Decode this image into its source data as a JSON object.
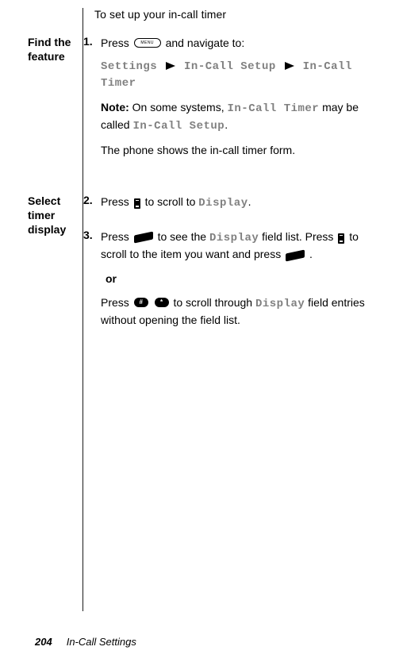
{
  "intro": "To set up your in-call timer",
  "sections": {
    "find": {
      "label": "Find the feature",
      "step1": {
        "num": "1.",
        "press_pre": "Press ",
        "press_post": " and navigate to:",
        "menu_button_text": "MENU",
        "path_settings": "Settings",
        "path_setup": "In-Call Setup",
        "path_timer": "In-Call Timer",
        "note_label": "Note:",
        "note_pre": " On some systems, ",
        "note_timer": "In-Call Timer",
        "note_mid": " may be called ",
        "note_setup": "In-Call Setup",
        "note_end": ".",
        "result": "The phone shows the in-call timer form."
      }
    },
    "select": {
      "label": "Select timer display",
      "step2": {
        "num": "2.",
        "press_pre": "Press ",
        "press_mid": " to scroll to ",
        "display": "Display",
        "end": "."
      },
      "step3": {
        "num": "3.",
        "line1_a": "Press ",
        "line1_b": " to see the ",
        "display": "Display",
        "line1_c": " field list. Press ",
        "line1_d": " to scroll to the item you want and press ",
        "line1_e": ".",
        "or": "or",
        "line2_a": "Press ",
        "hash_text": "#",
        "star_text": "*",
        "line2_b": " to scroll through ",
        "line2_c": " field entries without opening the field list."
      }
    }
  },
  "footer": {
    "page": "204",
    "title": "In-Call Settings"
  }
}
